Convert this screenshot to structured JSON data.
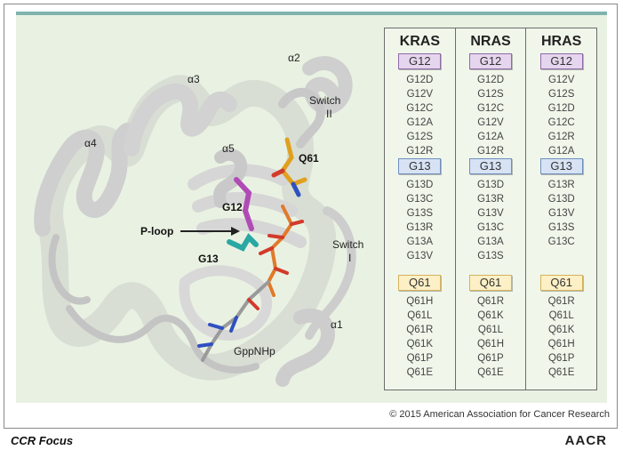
{
  "structure_labels": {
    "alpha2": "α2",
    "alpha3": "α3",
    "alpha4": "α4",
    "alpha5": "α5",
    "alpha1": "α1",
    "switch2_line1": "Switch",
    "switch2_line2": "II",
    "switch1_line1": "Switch",
    "switch1_line2": "I",
    "q61": "Q61",
    "g12": "G12",
    "g13": "G13",
    "ploop": "P-loop",
    "ligand": "GppNHp"
  },
  "table": {
    "columns": [
      {
        "name": "KRAS",
        "g12_label": "G12",
        "g12": [
          "G12D",
          "G12V",
          "G12C",
          "G12A",
          "G12S",
          "G12R"
        ],
        "g13_label": "G13",
        "g13": [
          "G13D",
          "G13C",
          "G13S",
          "G13R",
          "G13A",
          "G13V"
        ],
        "q61_label": "Q61",
        "q61": [
          "Q61H",
          "Q61L",
          "Q61R",
          "Q61K",
          "Q61P",
          "Q61E"
        ]
      },
      {
        "name": "NRAS",
        "g12_label": "G12",
        "g12": [
          "G12D",
          "G12S",
          "G12C",
          "G12V",
          "G12A",
          "G12R"
        ],
        "g13_label": "G13",
        "g13": [
          "G13D",
          "G13R",
          "G13V",
          "G13C",
          "G13A",
          "G13S"
        ],
        "q61_label": "Q61",
        "q61": [
          "Q61R",
          "Q61K",
          "Q61L",
          "Q61H",
          "Q61P",
          "Q61E"
        ]
      },
      {
        "name": "HRAS",
        "g12_label": "G12",
        "g12": [
          "G12V",
          "G12S",
          "G12D",
          "G12C",
          "G12R",
          "G12A"
        ],
        "g13_label": "G13",
        "g13": [
          "G13R",
          "G13D",
          "G13V",
          "G13S",
          "G13C"
        ],
        "q61_label": "Q61",
        "q61": [
          "Q61R",
          "Q61L",
          "Q61K",
          "Q61H",
          "Q61P",
          "Q61E"
        ]
      }
    ]
  },
  "copyright": "© 2015 American Association for Cancer Research",
  "footer": {
    "left": "CCR Focus",
    "right": "AACR"
  },
  "colors": {
    "g12": "#b04bb5",
    "g13": "#2aa7a3",
    "q61": "#e0a020",
    "ligand": "#e07a2a",
    "panel": "#e9f2e2"
  }
}
